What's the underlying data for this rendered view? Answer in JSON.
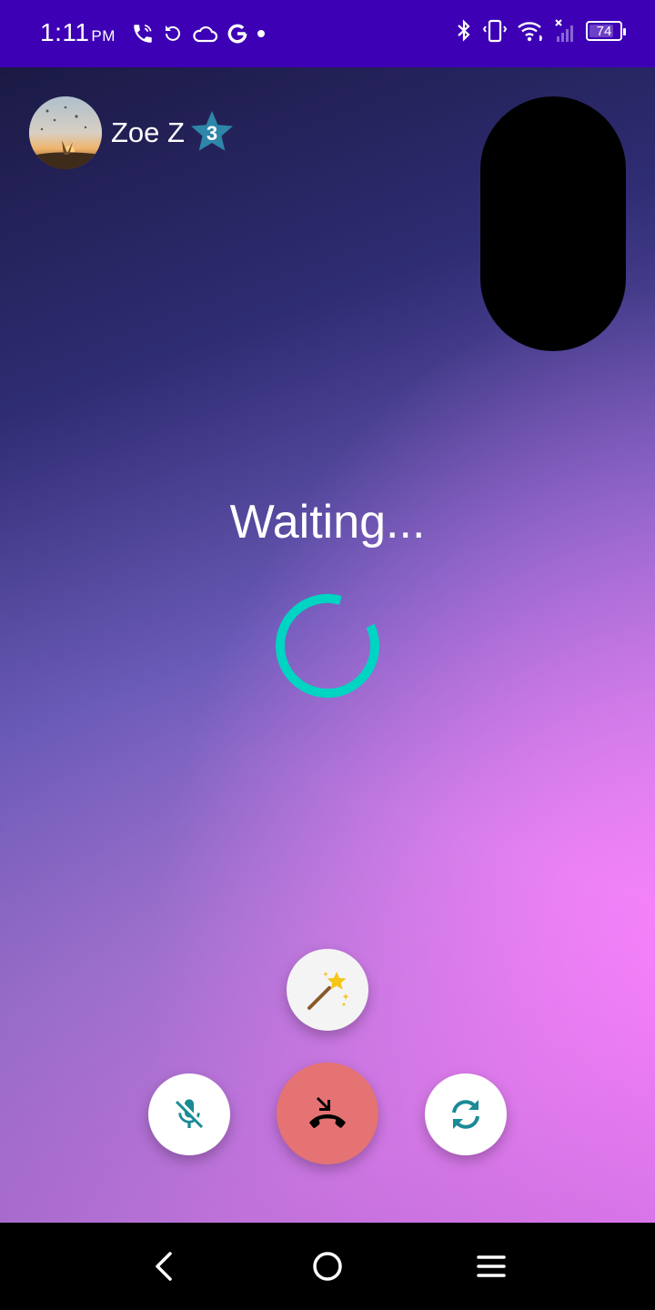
{
  "status_bar": {
    "time": "1:11",
    "ampm": "PM",
    "battery_level": "74",
    "icons_left": [
      "wifi-call-icon",
      "sync-icon",
      "cloud-icon",
      "google-icon",
      "dot-icon"
    ],
    "icons_right": [
      "bluetooth-icon",
      "vibrate-icon",
      "wifi-icon",
      "signal-icon",
      "battery-icon"
    ]
  },
  "caller": {
    "name": "Zoe Z",
    "level": "3",
    "badge_color": "#2e86a8"
  },
  "call": {
    "status_text": "Waiting...",
    "spinner_color": "#00d4c2",
    "end_button_color": "#e57373",
    "accent_icon_color": "#1a8a95"
  },
  "controls": {
    "effects": "magic-wand-icon",
    "mute": "mic-off-icon",
    "end_call": "call-end-icon",
    "switch_camera": "camera-switch-icon"
  },
  "nav": {
    "back": "back-icon",
    "home": "home-icon",
    "menu": "menu-icon"
  }
}
